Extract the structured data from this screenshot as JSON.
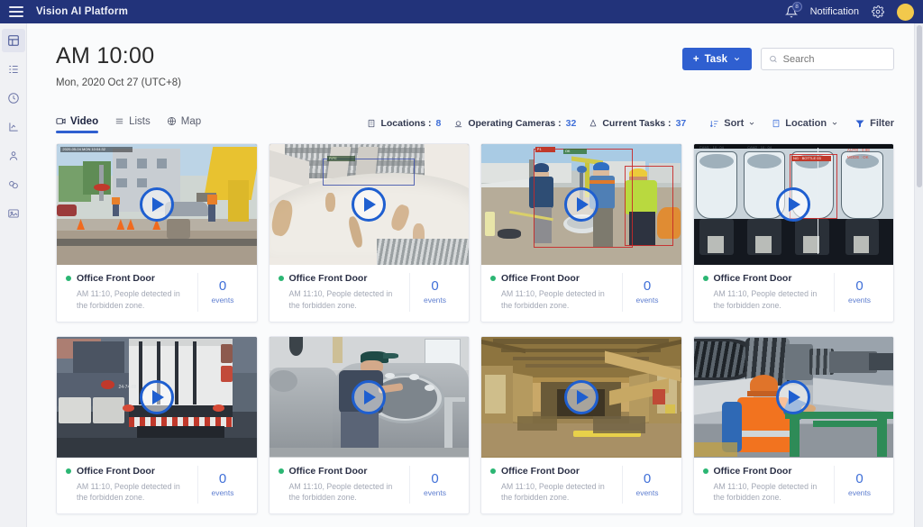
{
  "topbar": {
    "menu_icon": "hamburger-icon",
    "brand": "Vision AI Platform",
    "bell_icon": "bell-icon",
    "notification_badge": "8",
    "notification_label": "Notification",
    "settings_icon": "gear-icon",
    "avatar": "user-avatar",
    "bg_color": "#22337a"
  },
  "sidebar": {
    "items": [
      {
        "name": "dashboard",
        "icon": "dashboard-icon",
        "active": true
      },
      {
        "name": "lists",
        "icon": "list-icon",
        "active": false
      },
      {
        "name": "history",
        "icon": "clock-history-icon",
        "active": false
      },
      {
        "name": "analytics",
        "icon": "chart-icon",
        "active": false
      },
      {
        "name": "users",
        "icon": "person-icon",
        "active": false
      },
      {
        "name": "devices",
        "icon": "cameras-icon",
        "active": false
      },
      {
        "name": "reports",
        "icon": "media-card-icon",
        "active": false
      }
    ]
  },
  "header": {
    "time": "AM 10:00",
    "date": "Mon, 2020 Oct 27 (UTC+8)",
    "task_button": "Task",
    "task_plus": "+",
    "task_caret": "⌄",
    "search_placeholder": "Search",
    "search_value": "",
    "search_icon": "search-icon"
  },
  "tabs": [
    {
      "label": "Video",
      "icon": "video-icon",
      "active": true
    },
    {
      "label": "Lists",
      "icon": "list-icon",
      "active": false
    },
    {
      "label": "Map",
      "icon": "globe-icon",
      "active": false
    }
  ],
  "stats": [
    {
      "label": "Locations :",
      "value": "8",
      "icon": "building-icon"
    },
    {
      "label": "Operating Cameras :",
      "value": "32",
      "icon": "camera-icon"
    },
    {
      "label": "Current Tasks :",
      "value": "37",
      "icon": "task-icon"
    }
  ],
  "tools": [
    {
      "label": "Sort",
      "icon": "sort-icon",
      "caret": "⌄"
    },
    {
      "label": "Location",
      "icon": "building-icon",
      "caret": "⌄"
    },
    {
      "label": "Filter",
      "icon": "filter-icon",
      "caret": ""
    }
  ],
  "colors": {
    "accent": "#2f5fd0",
    "navy": "#22337a",
    "status_online": "#2bb673",
    "events_blue": "#3f6fd8",
    "avatar_yellow": "#f2c94c"
  },
  "cards": [
    {
      "scene": "street-construction",
      "status": "online",
      "title": "Office Front Door",
      "desc": "AM 11:10, People detected in the forbidden zone.",
      "events": "0",
      "events_label": "events",
      "play_icon": "play-icon"
    },
    {
      "scene": "white-pipe-grating",
      "status": "online",
      "title": "Office Front Door",
      "desc": "AM 11:10, People detected in the forbidden zone.",
      "events": "0",
      "events_label": "events",
      "play_icon": "play-icon"
    },
    {
      "scene": "manhole-workers",
      "status": "online",
      "title": "Office Front Door",
      "desc": "AM 11:10, People detected in the forbidden zone.",
      "events": "0",
      "events_label": "events",
      "play_icon": "play-icon"
    },
    {
      "scene": "bottle-inspection",
      "status": "online",
      "title": "Office Front Door",
      "desc": "AM 11:10, People detected in the forbidden zone.",
      "events": "0",
      "events_label": "events",
      "play_icon": "play-icon"
    },
    {
      "scene": "truck-rear",
      "status": "online",
      "title": "Office Front Door",
      "desc": "AM 11:10, People detected in the forbidden zone.",
      "events": "0",
      "events_label": "events",
      "play_icon": "play-icon"
    },
    {
      "scene": "brewery-tank",
      "status": "online",
      "title": "Office Front Door",
      "desc": "AM 11:10, People detected in the forbidden zone.",
      "events": "0",
      "events_label": "events",
      "play_icon": "play-icon"
    },
    {
      "scene": "warehouse-interior",
      "status": "online",
      "title": "Office Front Door",
      "desc": "AM 11:10, People detected in the forbidden zone.",
      "events": "0",
      "events_label": "events",
      "play_icon": "play-icon"
    },
    {
      "scene": "turbine-rotor-worker",
      "status": "online",
      "title": "Office Front Door",
      "desc": "AM 11:10, People detected in the forbidden zone.",
      "events": "0",
      "events_label": "events",
      "play_icon": "play-icon"
    }
  ]
}
